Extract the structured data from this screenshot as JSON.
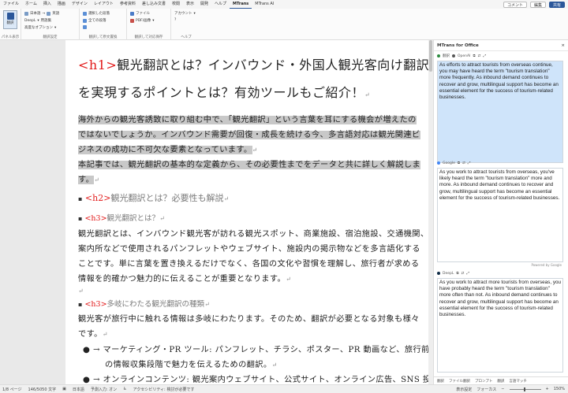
{
  "menubar": {
    "tabs": [
      "ファイル",
      "ホーム",
      "挿入",
      "描画",
      "デザイン",
      "レイアウト",
      "参考資料",
      "差し込み文書",
      "校閲",
      "表示",
      "開発",
      "ヘルプ",
      "MTrans",
      "MTrans AI"
    ],
    "active_tab": "MTrans",
    "comment": "コメント",
    "edit": "編集",
    "share": "共有"
  },
  "ribbon": {
    "translate_button": "翻訳",
    "panel_display": "パネル表示",
    "lang1": "日本語",
    "lang1_arrow": "英語",
    "engine": "DeepL",
    "style": "用語集",
    "advanced": "高度なオプション",
    "group_translate_settings": "翻訳設定",
    "opt1": "選択した段落",
    "opt2": "全ての段落",
    "opt3": "",
    "group_after": "翻訳して原文置換",
    "file": "ファイル",
    "pdf": "PDF/画像",
    "group_file": "翻訳して対応保存",
    "account": "アカウント",
    "help": "ヘルプ",
    "group_help": "ヘルプ"
  },
  "document": {
    "h1_tag": "<h1>",
    "h1_line1": "観光翻訳とは？インバウンド・外国人観光客向け翻訳",
    "h1_line2": "を実現するポイントとは？有効ツールもご紹介！",
    "p1_line1": "海外からの観光客誘致に取り組む中で、「観光翻訳」という言葉を耳にする機会が増えたの",
    "p1_line2": "ではないでしょうか。インバウンド需要が回復・成長を続ける今、多言語対応は観光関連ビ",
    "p1_line3": "ジネスの成功に不可欠な要素となっています。",
    "p2_line1": "本記事では、観光翻訳の基本的な定義から、その必要性までをデータと共に詳しく解説しま",
    "p2_line2": "す。",
    "h2_tag": "<h2>",
    "h2_text": "観光翻訳とは？必要性も解説",
    "h3a_tag": "<h3>",
    "h3a_text": "観光翻訳とは？",
    "p3_line1": "観光翻訳とは、インバウンド観光客が訪れる観光スポット、商業施設、宿泊施設、交通機関、",
    "p3_line2": "案内所などで使用されるパンフレットやウェブサイト、施設内の掲示物などを多言語化する",
    "p3_line3": "ことです。単に言葉を置き換えるだけでなく、各国の文化や習慣を理解し、旅行者が求める",
    "p3_line4": "情報を的確かつ魅力的に伝えることが重要となります。",
    "h3b_tag": "<h3>",
    "h3b_text": "多岐にわたる観光翻訳の種類",
    "p4_line1": "観光客が旅行中に触れる情報は多岐にわたります。そのため、翻訳が必要となる対象も様々",
    "p4_line2": "です。",
    "b1_line1": "マーケティング・PR ツール: パンフレット、チラシ、ポスター、PR 動画など、旅行前",
    "b1_line2": "の情報収集段階で魅力を伝えるための翻訳。",
    "b2_line1": "オンラインコンテンツ: 観光案内ウェブサイト、公式サイト、オンライン広告、SNS 投",
    "return_mark": "↵"
  },
  "pane": {
    "title": "MTrans for Office",
    "close": "×",
    "engine1": "翻訳",
    "engine1b": "OpenAI",
    "text1": "As efforts to attract tourists from overseas continue, you may have heard the term \"tourism translation\" more frequently. As inbound demand continues to recover and grow, multilingual support has become an essential element for the success of tourism-related businesses.",
    "engine2": "Google",
    "text2": "As you work to attract tourists from overseas, you've likely heard the term \"tourism translation\" more and more. As inbound demand continues to recover and grow, multilingual support has become an essential element for the success of tourism-related businesses.",
    "google_brand": "Powered by Google",
    "engine3": "DeepL",
    "text3": "As you work to attract more tourists from overseas, you have probably heard the term \"tourism translation\" more often than not. As inbound demand continues to recover and grow, multilingual support has become an essential element for the success of tourism-related businesses.",
    "tabs": [
      "翻訳",
      "ファイル翻訳",
      "プロンプト",
      "翻訳",
      "言語マッチ"
    ]
  },
  "status": {
    "page": "1/8 ページ",
    "words": "146/5050 文字",
    "lang": "日本語",
    "ime": "予測入力: オン",
    "access": "アクセシビリティ: 検討が必要です",
    "focus": "フォーカス",
    "settings": "表示設定",
    "zoom": "150%"
  },
  "colors": {
    "accent": "#2b579a",
    "tag_red": "#e21b1b",
    "highlight": "#c8c8c8",
    "selected_pane": "#cfe4fa"
  }
}
